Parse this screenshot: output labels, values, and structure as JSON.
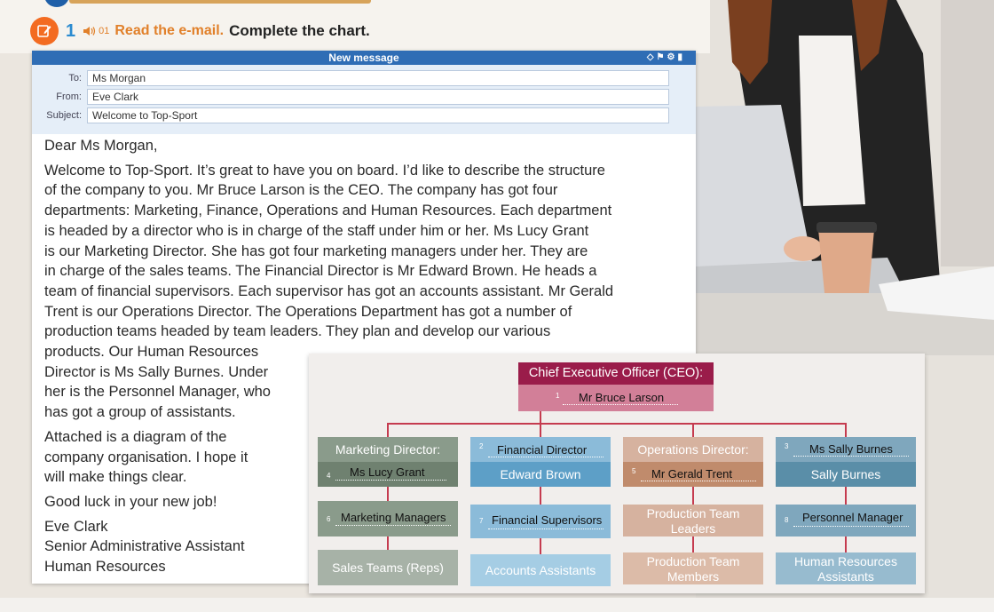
{
  "exercise": {
    "number": "1",
    "audio_track": "01",
    "instruction_part1": "Read the e-mail.",
    "instruction_part2": "Complete the chart."
  },
  "email": {
    "window_title": "New message",
    "fields": {
      "to_label": "To:",
      "to_value": "Ms Morgan",
      "from_label": "From:",
      "from_value": "Eve Clark",
      "subject_label": "Subject:",
      "subject_value": "Welcome to Top-Sport"
    },
    "greeting": "Dear Ms Morgan,",
    "paragraph1_lines": [
      "Welcome to Top-Sport. It’s great to have you on board. I’d like to describe the structure",
      "of the company to you. Mr Bruce Larson is the CEO. The company has got four",
      "departments: Marketing, Finance, Operations and Human Resources. Each department",
      "is headed by a director who is in charge of the staff under him or her. Ms Lucy Grant",
      "is our Marketing Director. She has got four marketing managers under her. They are",
      "in charge of the sales teams. The Financial Director is Mr Edward Brown. He heads a",
      "team of financial supervisors. Each supervisor has got an accounts assistant. Mr Gerald",
      "Trent is our Operations Director. The Operations Department has got a number of",
      "production teams headed by team leaders. They plan and develop our various",
      "products. Our Human Resources",
      "Director is Ms Sally Burnes. Under",
      "her is the Personnel Manager, who",
      "has got a group of assistants."
    ],
    "paragraph2_lines": [
      "Attached is a diagram of the",
      "company organisation. I hope it",
      "will make things clear."
    ],
    "good_luck": "Good luck in your new job!",
    "signature": [
      "Eve Clark",
      "Senior Administrative Assistant",
      "Human Resources"
    ]
  },
  "org_chart": {
    "ceo_title": "Chief Executive Officer (CEO):",
    "ceo_answer": "Mr Bruce Larson",
    "ceo_num": "1",
    "marketing": {
      "title": "Marketing Director:",
      "answer_name": "Ms Lucy Grant",
      "name_num": "4",
      "level2_answer": "Marketing Managers",
      "level2_num": "6",
      "level3": "Sales Teams (Reps)"
    },
    "finance": {
      "title_num": "2",
      "title_answer": "Financial Director",
      "name": "Edward Brown",
      "level2_answer": "Financial Supervisors",
      "level2_num": "7",
      "level3": "Accounts Assistants"
    },
    "operations": {
      "title": "Operations Director:",
      "name_num": "5",
      "name_answer": "Mr Gerald Trent",
      "level2_lines": [
        "Production Team",
        "Leaders"
      ],
      "level3_lines": [
        "Production Team",
        "Members"
      ]
    },
    "hr": {
      "title_num": "3",
      "title_answer": "Ms Sally Burnes",
      "name": "Sally Burnes",
      "level2_num": "8",
      "level2_answer": "Personnel Manager",
      "level3_lines": [
        "Human Resources",
        "Assistants"
      ]
    }
  },
  "colors": {
    "ceo_dark": "#9a1c4a",
    "ceo_light": "#d27f98",
    "marketing_dark": "#8a9b8b",
    "marketing_mid": "#6f8170",
    "finance_dark": "#8bbbd9",
    "finance_mid": "#5d9fc7",
    "operations_dark": "#d6b29f",
    "operations_mid": "#c08b6c",
    "hr_dark": "#7fa7bd",
    "hr_mid": "#5a8ea8",
    "connector": "#c53b4f"
  }
}
